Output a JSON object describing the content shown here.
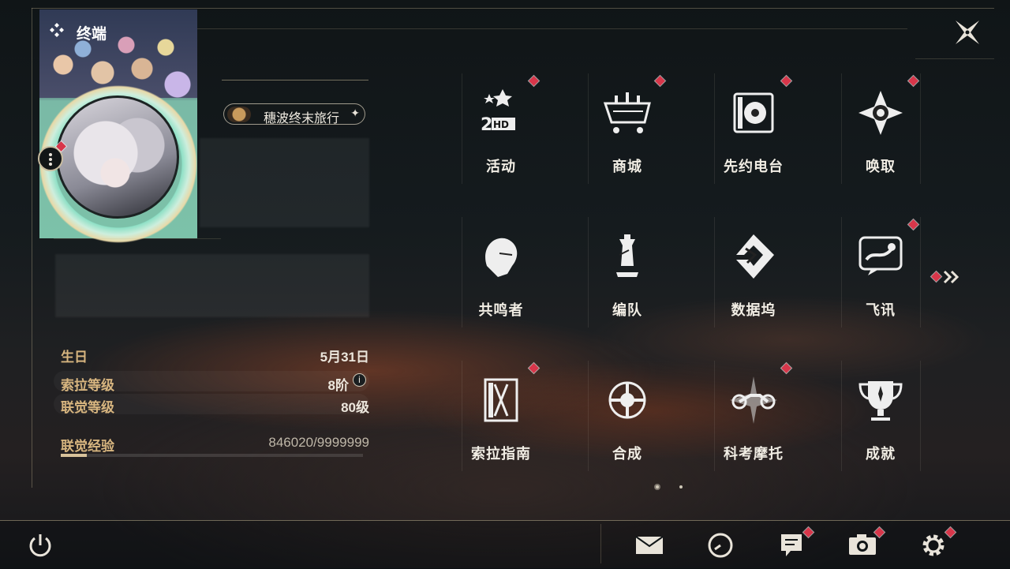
{
  "panel": {
    "title": "终端"
  },
  "profile": {
    "nickname": "穗波终末旅行",
    "stats": [
      {
        "label": "生日",
        "value": "5月31日"
      },
      {
        "label": "索拉等级",
        "value": "8阶"
      },
      {
        "label": "联觉等级",
        "value": "80级"
      }
    ],
    "exp": {
      "label": "联觉经验",
      "value": "846020/9999999",
      "fraction": 0.085
    }
  },
  "grid": [
    {
      "label": "活动",
      "icon": "event-2hd-icon",
      "badge": true
    },
    {
      "label": "商城",
      "icon": "shop-cart-icon",
      "badge": true
    },
    {
      "label": "先约电台",
      "icon": "radio-icon",
      "badge": true
    },
    {
      "label": "唤取",
      "icon": "convene-icon",
      "badge": true
    },
    {
      "label": "共鸣者",
      "icon": "resonator-icon",
      "badge": false
    },
    {
      "label": "编队",
      "icon": "chess-team-icon",
      "badge": false
    },
    {
      "label": "数据坞",
      "icon": "data-bank-icon",
      "badge": false
    },
    {
      "label": "飞讯",
      "icon": "chat-icon",
      "badge": true
    },
    {
      "label": "索拉指南",
      "icon": "guide-book-icon",
      "badge": true
    },
    {
      "label": "合成",
      "icon": "synthesis-icon",
      "badge": false
    },
    {
      "label": "科考摩托",
      "icon": "motorcycle-icon",
      "badge": true
    },
    {
      "label": "成就",
      "icon": "trophy-icon",
      "badge": false
    }
  ],
  "pagination": {
    "pages": 2,
    "current": 1
  },
  "colors": {
    "accent_gold": "#d7b57f",
    "badge_red": "#d8364a",
    "frame": "#c9bda0"
  }
}
